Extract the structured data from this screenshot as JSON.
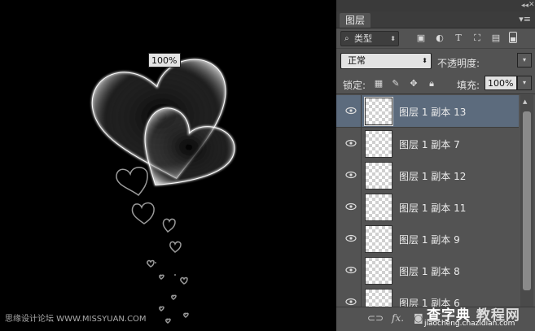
{
  "canvas": {
    "watermark_left": "思缘设计论坛 WWW.MISSYUAN.COM"
  },
  "panel": {
    "tab_label": "图层",
    "filter": {
      "label": "类型"
    },
    "blend_mode": "正常",
    "opacity_label": "不透明度:",
    "opacity_value": "100%",
    "lock_label": "锁定:",
    "fill_label": "填充:",
    "fill_value": "100%",
    "layers": [
      {
        "name": "图层 1 副本 13",
        "selected": true
      },
      {
        "name": "图层 1 副本 7",
        "selected": false
      },
      {
        "name": "图层 1 副本 12",
        "selected": false
      },
      {
        "name": "图层 1 副本 11",
        "selected": false
      },
      {
        "name": "图层 1 副本 9",
        "selected": false
      },
      {
        "name": "图层 1 副本 8",
        "selected": false
      },
      {
        "name": "图层 1 副本 6",
        "selected": false
      }
    ]
  },
  "watermark_right": {
    "line1_a": "查字典",
    "line1_b": "教程网",
    "line2": "jiaocheng.chazidian.com"
  },
  "colors": {
    "panel_bg": "#535353",
    "selected_layer": "#5c6b7d",
    "canvas_bg": "#000000"
  }
}
